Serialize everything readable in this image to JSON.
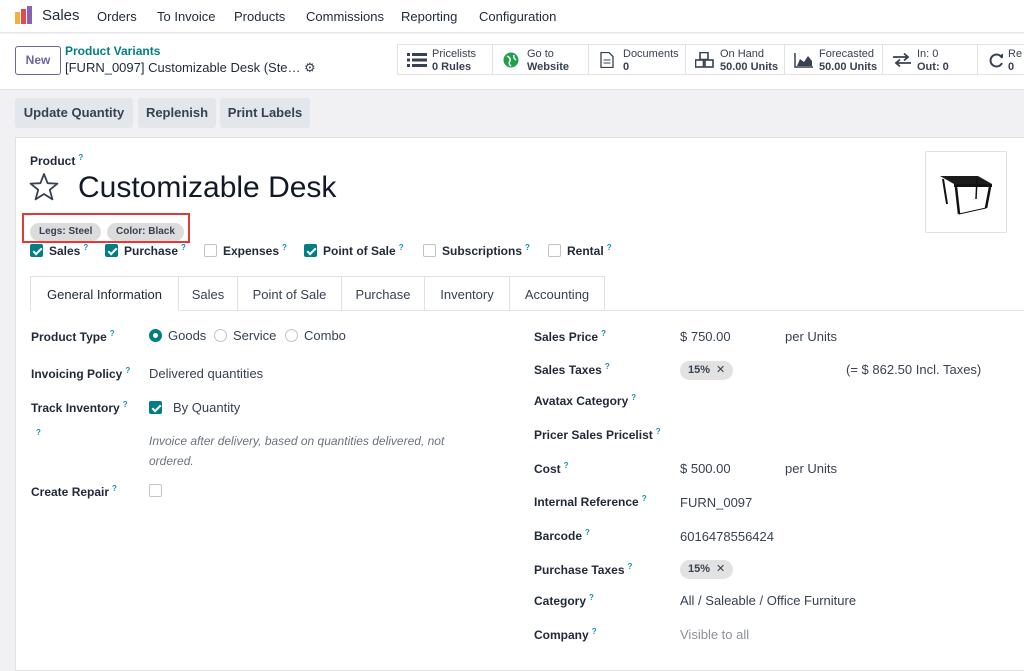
{
  "topnav": {
    "app_name": "Sales",
    "menu": [
      "Orders",
      "To Invoice",
      "Products",
      "Commissions",
      "Reporting",
      "Configuration"
    ]
  },
  "control_panel": {
    "new_label": "New",
    "breadcrumb_parent": "Product Variants",
    "breadcrumb_record": "[FURN_0097] Customizable Desk (Ste…",
    "smart_buttons": [
      {
        "icon": "list-icon",
        "line1": "Pricelists",
        "line2": "0 Rules"
      },
      {
        "icon": "globe-icon",
        "line1": "Go to",
        "line2": "Website"
      },
      {
        "icon": "document-icon",
        "line1": "Documents",
        "line2": "0"
      },
      {
        "icon": "cubes-icon",
        "line1": "On Hand",
        "line2": "50.00 Units"
      },
      {
        "icon": "area-chart-icon",
        "line1": "Forecasted",
        "line2": "50.00 Units"
      },
      {
        "icon": "exchange-icon",
        "line1": "In: 0",
        "line2": "Out: 0"
      },
      {
        "icon": "refresh-icon",
        "line1": "Re",
        "line2": "0"
      }
    ]
  },
  "actions": [
    "Update Quantity",
    "Replenish",
    "Print Labels"
  ],
  "product": {
    "label": "Product",
    "name": "Customizable Desk",
    "tags": [
      "Legs: Steel",
      "Color: Black"
    ],
    "flags": [
      {
        "label": "Sales",
        "checked": true
      },
      {
        "label": "Purchase",
        "checked": true
      },
      {
        "label": "Expenses",
        "checked": false
      },
      {
        "label": "Point of Sale",
        "checked": true
      },
      {
        "label": "Subscriptions",
        "checked": false
      },
      {
        "label": "Rental",
        "checked": false
      }
    ]
  },
  "tabs": [
    "General Information",
    "Sales",
    "Point of Sale",
    "Purchase",
    "Inventory",
    "Accounting"
  ],
  "left": {
    "product_type_label": "Product Type",
    "product_type_options": [
      "Goods",
      "Service",
      "Combo"
    ],
    "product_type_selected": "Goods",
    "invoicing_policy_label": "Invoicing Policy",
    "invoicing_policy_value": "Delivered quantities",
    "track_inventory_label": "Track Inventory",
    "track_inventory_value": "By Quantity",
    "invoice_note": "Invoice after delivery, based on quantities delivered, not ordered.",
    "create_repair_label": "Create Repair"
  },
  "right": {
    "sales_price_label": "Sales Price",
    "sales_price_value": "$ 750.00",
    "sales_price_unit": "per Units",
    "sales_taxes_label": "Sales Taxes",
    "sales_taxes_tag": "15%",
    "sales_taxes_incl": "(= $ 862.50 Incl. Taxes)",
    "avatax_label": "Avatax Category",
    "pricer_label": "Pricer Sales Pricelist",
    "cost_label": "Cost",
    "cost_value": "$ 500.00",
    "cost_unit": "per Units",
    "internal_ref_label": "Internal Reference",
    "internal_ref_value": "FURN_0097",
    "barcode_label": "Barcode",
    "barcode_value": "6016478556424",
    "purchase_taxes_label": "Purchase Taxes",
    "purchase_taxes_tag": "15%",
    "category_label": "Category",
    "category_value": "All / Saleable / Office Furniture",
    "company_label": "Company",
    "company_value": "Visible to all"
  },
  "colors": {
    "accent": "#017e84",
    "brand": "#71639e",
    "highlight": "#e53935"
  }
}
